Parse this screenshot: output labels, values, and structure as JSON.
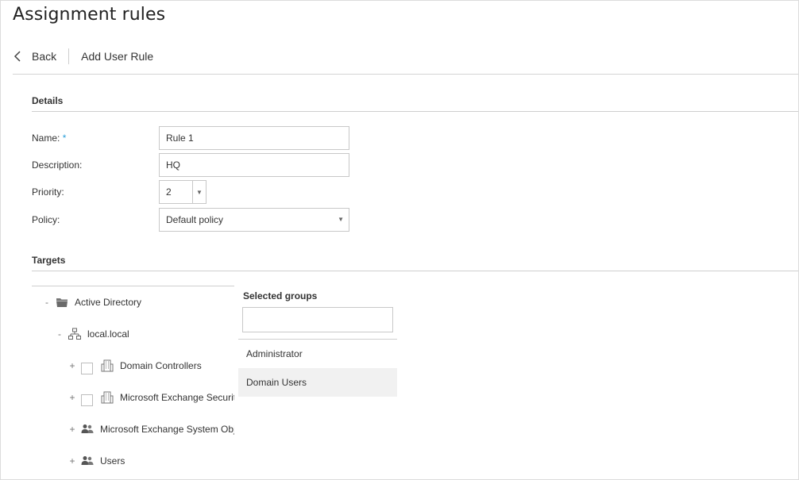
{
  "page": {
    "title": "Assignment rules"
  },
  "toolbar": {
    "back_label": "Back",
    "title": "Add User Rule"
  },
  "details": {
    "section_title": "Details",
    "name_label": "Name:",
    "name_required": "*",
    "name_value": "Rule 1",
    "description_label": "Description:",
    "description_value": "HQ",
    "priority_label": "Priority:",
    "priority_value": "2",
    "policy_label": "Policy:",
    "policy_value": "Default policy"
  },
  "targets": {
    "section_title": "Targets",
    "tree": {
      "root": {
        "toggle": "-",
        "label": "Active Directory",
        "icon": "folder-icon"
      },
      "domain": {
        "toggle": "-",
        "label": "local.local",
        "icon": "network-icon"
      },
      "children": [
        {
          "toggle": "+",
          "label": "Domain Controllers",
          "icon": "building-icon",
          "checkbox": true
        },
        {
          "toggle": "+",
          "label": "Microsoft Exchange Security Groups",
          "icon": "building-icon",
          "checkbox": true
        },
        {
          "toggle": "+",
          "label": "Microsoft Exchange System Objects",
          "icon": "users-icon",
          "checkbox": false
        },
        {
          "toggle": "+",
          "label": "Users",
          "icon": "users-icon",
          "checkbox": false
        }
      ]
    },
    "selected": {
      "title": "Selected groups",
      "search_value": "",
      "items": [
        "Administrator",
        "Domain Users"
      ]
    }
  }
}
